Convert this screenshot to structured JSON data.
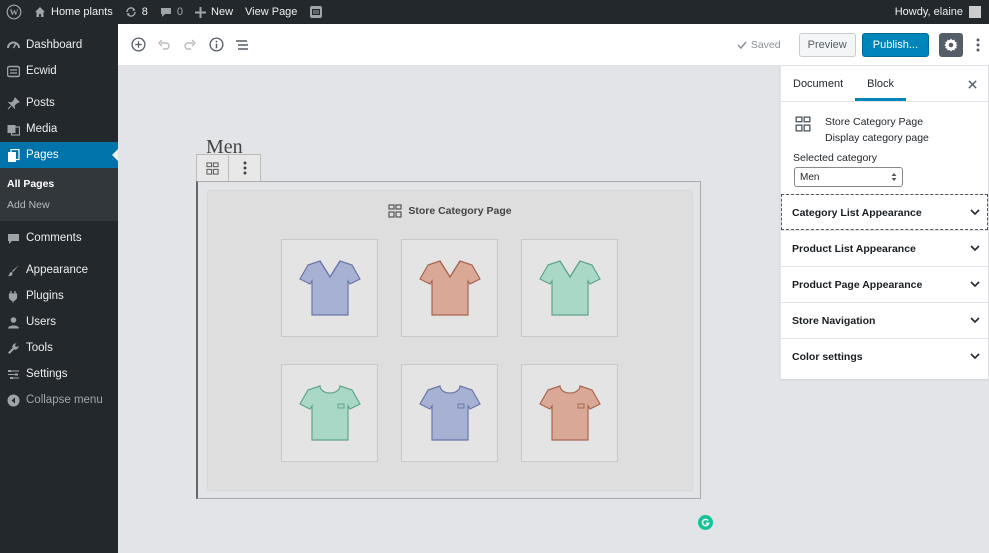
{
  "admin_bar": {
    "site_name": "Home plants",
    "updates_count": "8",
    "comments_count": "0",
    "new_label": "New",
    "view_page_label": "View Page",
    "greeting": "Howdy, elaine"
  },
  "sidebar": {
    "items": [
      {
        "label": "Dashboard",
        "icon": "dashboard-icon"
      },
      {
        "label": "Ecwid",
        "icon": "ecwid-icon"
      },
      {
        "label": "Posts",
        "icon": "pin-icon"
      },
      {
        "label": "Media",
        "icon": "media-icon"
      },
      {
        "label": "Pages",
        "icon": "pages-icon"
      },
      {
        "label": "Comments",
        "icon": "comments-icon"
      },
      {
        "label": "Appearance",
        "icon": "paintbrush-icon"
      },
      {
        "label": "Plugins",
        "icon": "plugin-icon"
      },
      {
        "label": "Users",
        "icon": "users-icon"
      },
      {
        "label": "Tools",
        "icon": "wrench-icon"
      },
      {
        "label": "Settings",
        "icon": "settings-icon"
      }
    ],
    "submenu": [
      "All Pages",
      "Add New"
    ],
    "collapse_label": "Collapse menu"
  },
  "header": {
    "saved_label": "Saved",
    "preview_label": "Preview",
    "publish_label": "Publish..."
  },
  "editor": {
    "post_title": "Men",
    "block_title": "Store Category Page"
  },
  "panel": {
    "tabs": [
      "Document",
      "Block"
    ],
    "active_tab": "Block",
    "block_name": "Store Category Page",
    "block_description": "Display category page",
    "selected_category_label": "Selected category",
    "selected_category_value": "Men",
    "sections": [
      "Category List Appearance",
      "Product List Appearance",
      "Product Page Appearance",
      "Store Navigation",
      "Color settings"
    ]
  },
  "colors": {
    "admin_dark": "#23282d",
    "accent_blue": "#0073aa",
    "publish_blue": "#0085ba",
    "shirt_blue": "#a7b1d3",
    "shirt_rust": "#d9a896",
    "shirt_green": "#a9d9c6",
    "grammarly_green": "#15c39a"
  }
}
